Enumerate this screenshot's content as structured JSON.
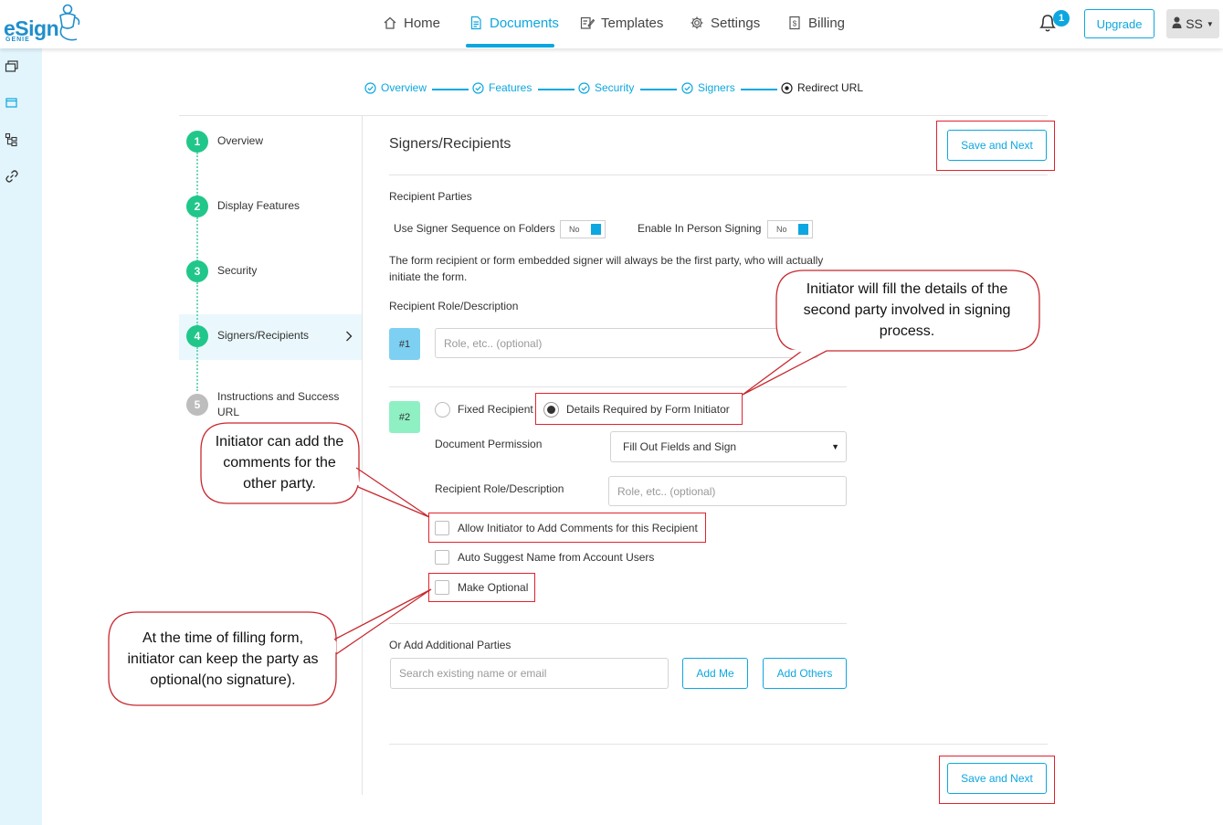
{
  "brand": {
    "name": "eSign",
    "sub": "GENIE"
  },
  "nav": {
    "home": "Home",
    "documents": "Documents",
    "templates": "Templates",
    "settings": "Settings",
    "billing": "Billing"
  },
  "header": {
    "notification_count": "1",
    "upgrade_label": "Upgrade",
    "user_initials": "SS"
  },
  "wizard": {
    "steps": [
      {
        "label": "Overview"
      },
      {
        "label": "Features"
      },
      {
        "label": "Security"
      },
      {
        "label": "Signers"
      },
      {
        "label": "Redirect URL"
      }
    ]
  },
  "sidebar_steps": [
    {
      "num": "1",
      "label": "Overview"
    },
    {
      "num": "2",
      "label": "Display Features"
    },
    {
      "num": "3",
      "label": "Security"
    },
    {
      "num": "4",
      "label": "Signers/Recipients"
    },
    {
      "num": "5",
      "label": "Instructions and Success URL"
    }
  ],
  "main": {
    "title": "Signers/Recipients",
    "save_next_label": "Save and Next",
    "recipient_parties_label": "Recipient Parties",
    "signer_sequence_label": "Use Signer Sequence on Folders",
    "signer_sequence_value": "No",
    "in_person_label": "Enable In Person Signing",
    "in_person_value": "No",
    "info_text": "The form recipient or form embedded signer will always be the first party, who will actually initiate the form.",
    "role_desc_label": "Recipient Role/Description",
    "party1_badge": "#1",
    "party1_placeholder": "Role, etc.. (optional)",
    "party2_badge": "#2",
    "fixed_recipient_label": "Fixed Recipient",
    "details_required_label": "Details Required by Form Initiator",
    "doc_permission_label": "Document Permission",
    "doc_permission_value": "Fill Out Fields and Sign",
    "party2_role_label": "Recipient Role/Description",
    "party2_placeholder": "Role, etc.. (optional)",
    "allow_comments_label": "Allow Initiator to Add Comments for this Recipient",
    "auto_suggest_label": "Auto Suggest Name from Account Users",
    "make_optional_label": "Make Optional",
    "additional_parties_label": "Or Add Additional Parties",
    "search_placeholder": "Search existing name or email",
    "add_me_label": "Add Me",
    "add_others_label": "Add Others"
  },
  "callouts": {
    "initiator_fill": "Initiator will fill the details of the second party involved in signing process.",
    "initiator_comments": "Initiator can add the comments for the other party.",
    "optional": "At the time of filling form, initiator can keep the party as optional(no signature)."
  },
  "colors": {
    "accent": "#0ca7e0",
    "green": "#21c78a",
    "highlight": "#e0232e"
  }
}
